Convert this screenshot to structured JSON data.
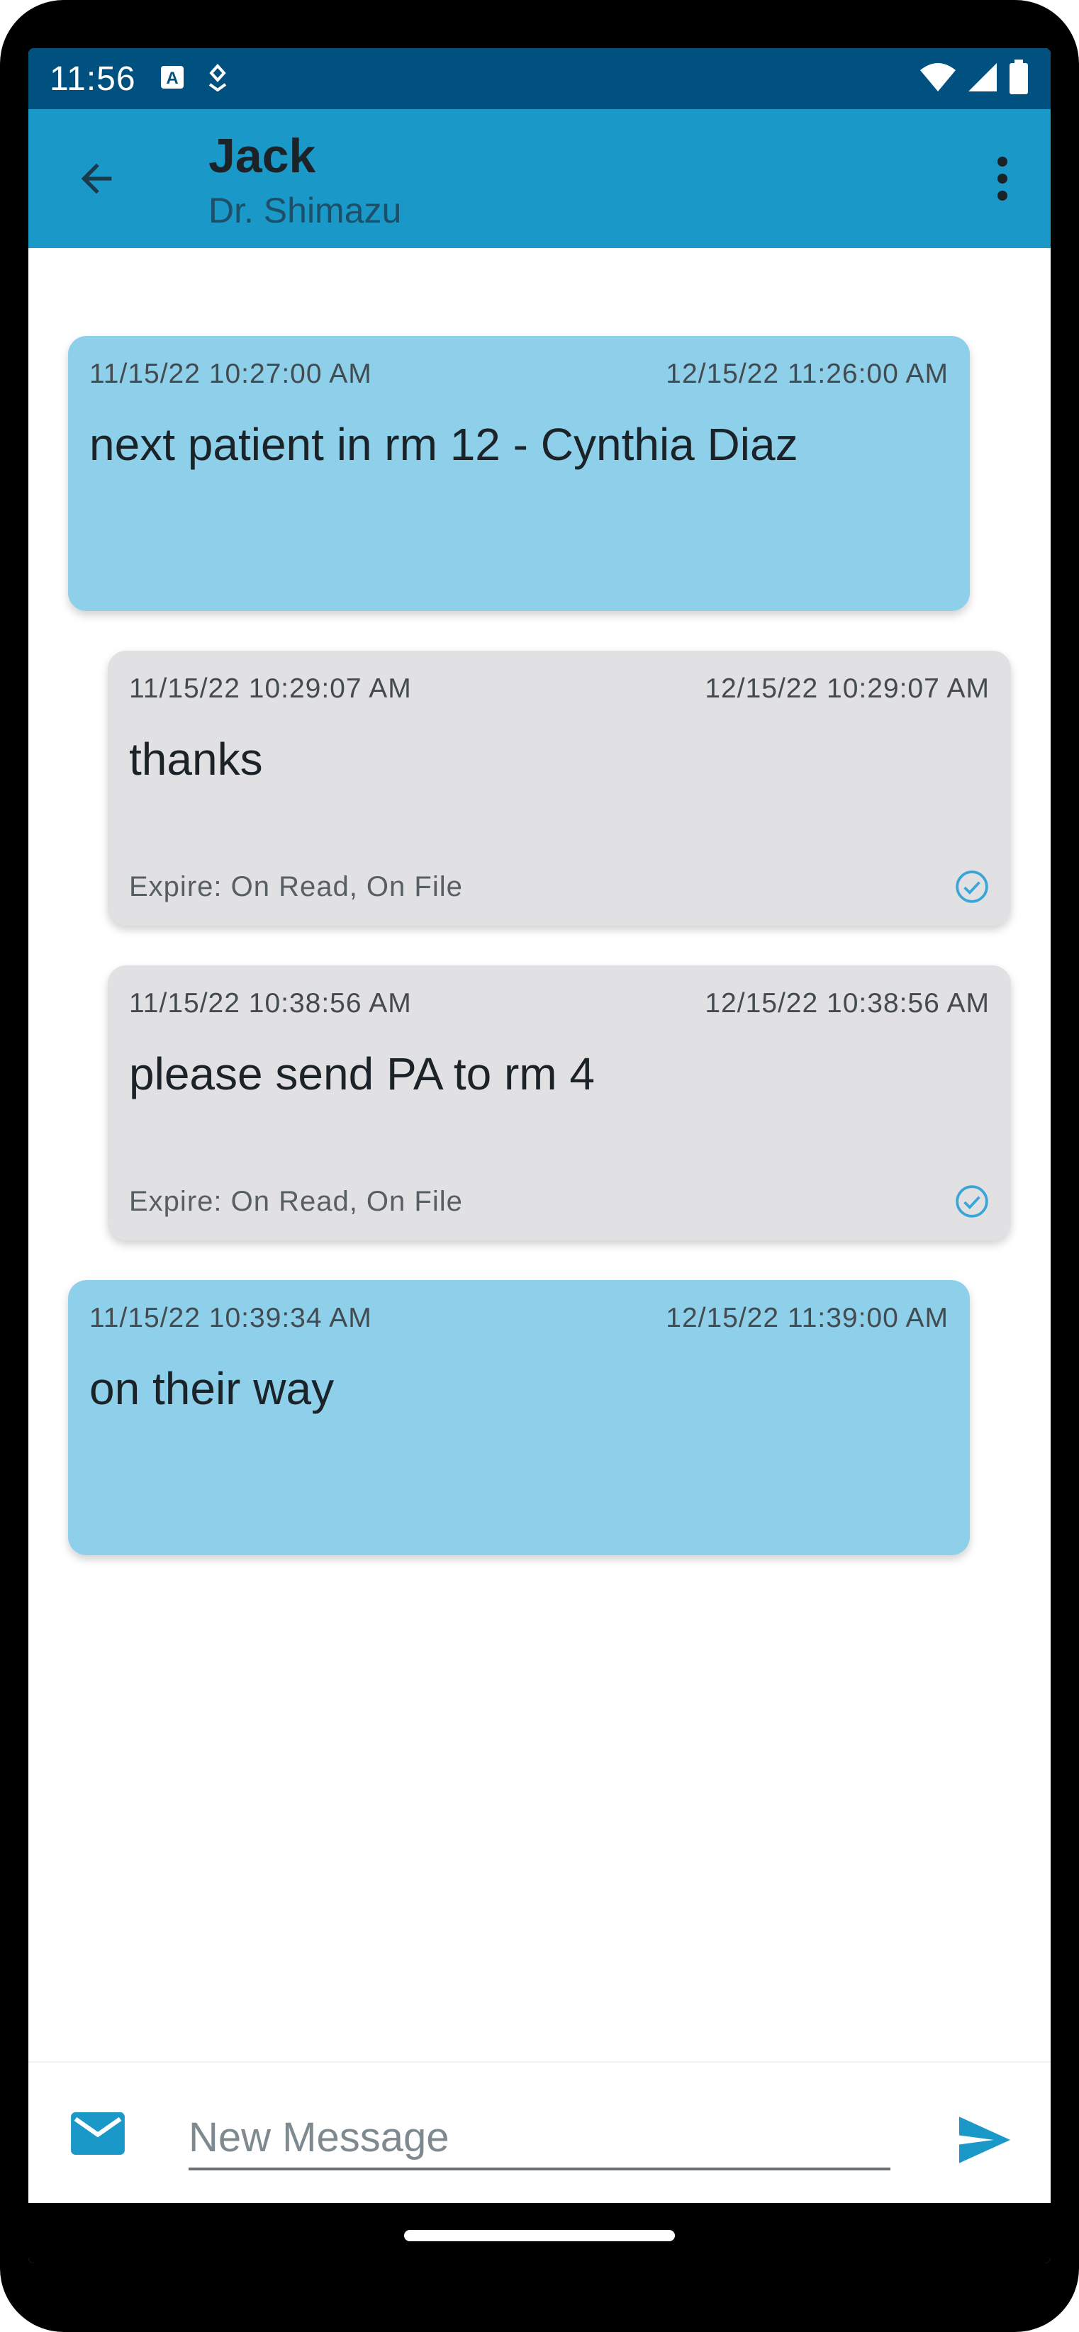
{
  "status_bar": {
    "time": "11:56",
    "icons": [
      "text-a-icon",
      "location-icon",
      "wifi-icon",
      "signal-icon",
      "battery-icon"
    ]
  },
  "app_bar": {
    "title": "Jack",
    "subtitle": "Dr. Shimazu",
    "color": "#1a98c8"
  },
  "messages": [
    {
      "type": "sent",
      "time_left": "11/15/22 10:27:00 AM",
      "time_right": "12/15/22 11:26:00 AM",
      "text": "next patient in rm 12 - Cynthia Diaz"
    },
    {
      "type": "recv",
      "time_left": "11/15/22 10:29:07 AM",
      "time_right": "12/15/22 10:29:07 AM",
      "text": "thanks",
      "expire": "Expire: On Read, On File"
    },
    {
      "type": "recv",
      "time_left": "11/15/22 10:38:56 AM",
      "time_right": "12/15/22 10:38:56 AM",
      "text": "please send PA to rm 4",
      "expire": "Expire: On Read, On File"
    },
    {
      "type": "sent",
      "time_left": "11/15/22 10:39:34 AM",
      "time_right": "12/15/22 11:39:00 AM",
      "text": "on their way"
    }
  ],
  "compose": {
    "placeholder": "New Message",
    "accent": "#1a98c8"
  }
}
